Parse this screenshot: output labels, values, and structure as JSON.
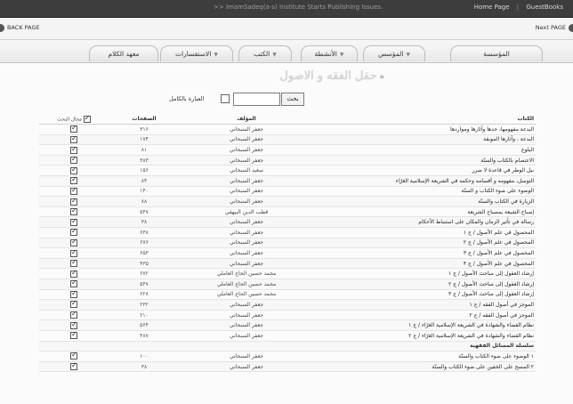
{
  "topbar": {
    "ticker": ">> ImamSadeq(a-s) Institute Starts Publishing Issues.",
    "home_link": "Home Page",
    "separator": "|",
    "guestbook_link": "GuestBooks"
  },
  "nav": {
    "back_label": "BACK PAGE",
    "next_label": "Next PAGE"
  },
  "menu": {
    "tabs": [
      {
        "label": "المؤسسة"
      },
      {
        "label": "المؤسس"
      },
      {
        "label": "الأنشطة"
      },
      {
        "label": "الكتب"
      },
      {
        "label": "الاستفسارات"
      },
      {
        "label": "معهد الكلام"
      }
    ]
  },
  "section": {
    "title": "حقل الفقه و الاصول",
    "bullet": "»"
  },
  "search": {
    "button_label": "بحث",
    "input_value": "",
    "exact_label": "العبارة بالكامل",
    "exact_checked": false
  },
  "table": {
    "headers": {
      "book": "الكتاب",
      "author": "المؤلف",
      "pages": "الصفحات",
      "search_field": "مجال البحث"
    },
    "rows": [
      {
        "book": "البدعة مفهومها، حدها وآثارها ومواردها",
        "author": "جعفر السبحاني",
        "pages": "٣١۶",
        "checked": true
      },
      {
        "book": "البدعة ، وآثارها الموبقة",
        "author": "جعفر السبحاني",
        "pages": "١٧۴",
        "checked": true
      },
      {
        "book": "البلوغ",
        "author": "جعفر السبحاني",
        "pages": "٨١",
        "checked": true
      },
      {
        "book": "الاعتصام بالكتاب والسنّة",
        "author": "جعفر السبحاني",
        "pages": "٣٨٣",
        "checked": true
      },
      {
        "book": "نيل الوطر في قاعدة لا ضرر",
        "author": "سعيد السبحاني",
        "pages": "١۵۶",
        "checked": true
      },
      {
        "book": "التوسل، مفهومه و أقسامه وحكمه في الشريعة الإسلامية الغرّاء",
        "author": "جعفر السبحاني",
        "pages": "٨۴",
        "checked": true
      },
      {
        "book": "الوضوء على ضوء الكتاب و السنّة",
        "author": "جعفر السبحاني",
        "pages": "١۴٠",
        "checked": true
      },
      {
        "book": "الزيارة في الكتاب والسنّة",
        "author": "جعفر السبحاني",
        "pages": "٨٨",
        "checked": true
      },
      {
        "book": "إصباح الشيعة بمصباح الشريعة",
        "author": "قطب الدين البيهقي",
        "pages": "۵۴٧",
        "checked": true
      },
      {
        "book": "رسالة في تأثير الزمان والمكان على استنباط الأحكام",
        "author": "جعفر السبحاني",
        "pages": "٣٨",
        "checked": true
      },
      {
        "book": "المحصول في علم الأصول / ج ١",
        "author": "جعفر السبحاني",
        "pages": "۶٣٨",
        "checked": true
      },
      {
        "book": "المحصول في علم الأصول / ج ٢",
        "author": "جعفر السبحاني",
        "pages": "۶٧۶",
        "checked": true
      },
      {
        "book": "المحصول في علم الأصول / ج ٣",
        "author": "جعفر السبحاني",
        "pages": "۶۵٣",
        "checked": true
      },
      {
        "book": "المحصول في علم الأصول / ج ۴",
        "author": "جعفر السبحاني",
        "pages": "۴٣۵",
        "checked": true
      },
      {
        "book": "إرشاد العقول إلى مباحث الأصول / ج ١",
        "author": "محمد حسين الحاج العاملي",
        "pages": "۶٧٢",
        "checked": true
      },
      {
        "book": "إرشاد العقول إلى مباحث الأصول / ج ٢",
        "author": "محمد حسين الحاج العاملي",
        "pages": "۵۴٧",
        "checked": true
      },
      {
        "book": "إرشاد العقول إلى مباحث الأصول / ج ٣",
        "author": "محمد حسين الحاج العاملي",
        "pages": "۶٢٨",
        "checked": true
      },
      {
        "book": "الموجز في أصول الفقه / ج ١",
        "author": "جعفر السبحاني",
        "pages": "٢٣٢",
        "checked": true
      },
      {
        "book": "الموجز في أصول الفقه / ج ٢",
        "author": "جعفر السبحاني",
        "pages": "٢١٠",
        "checked": true
      },
      {
        "book": "نظام القضاء والشهادة في الشريعة الإسلامية الغرّاء / ج ١",
        "author": "جعفر السبحاني",
        "pages": "۵۶۴",
        "checked": true
      },
      {
        "book": "نظام القضاء والشهادة في الشريعة الإسلامية الغرّاء / ج ٢",
        "author": "جعفر السبحاني",
        "pages": "۴٨٧",
        "checked": true
      },
      {
        "section": true,
        "book": "سلسلة المسائل الفقهية",
        "author": "",
        "pages": "",
        "checked": false
      },
      {
        "book": "١ الوضوء على ضوء الكتاب والسنّة",
        "author": "جعفر السبحاني",
        "pages": "١٠٠",
        "checked": true
      },
      {
        "book": "٢ المسح على الخفين على ضوء الكتاب والسنّة",
        "author": "جعفر السبحاني",
        "pages": "٣٨",
        "checked": true
      }
    ]
  }
}
